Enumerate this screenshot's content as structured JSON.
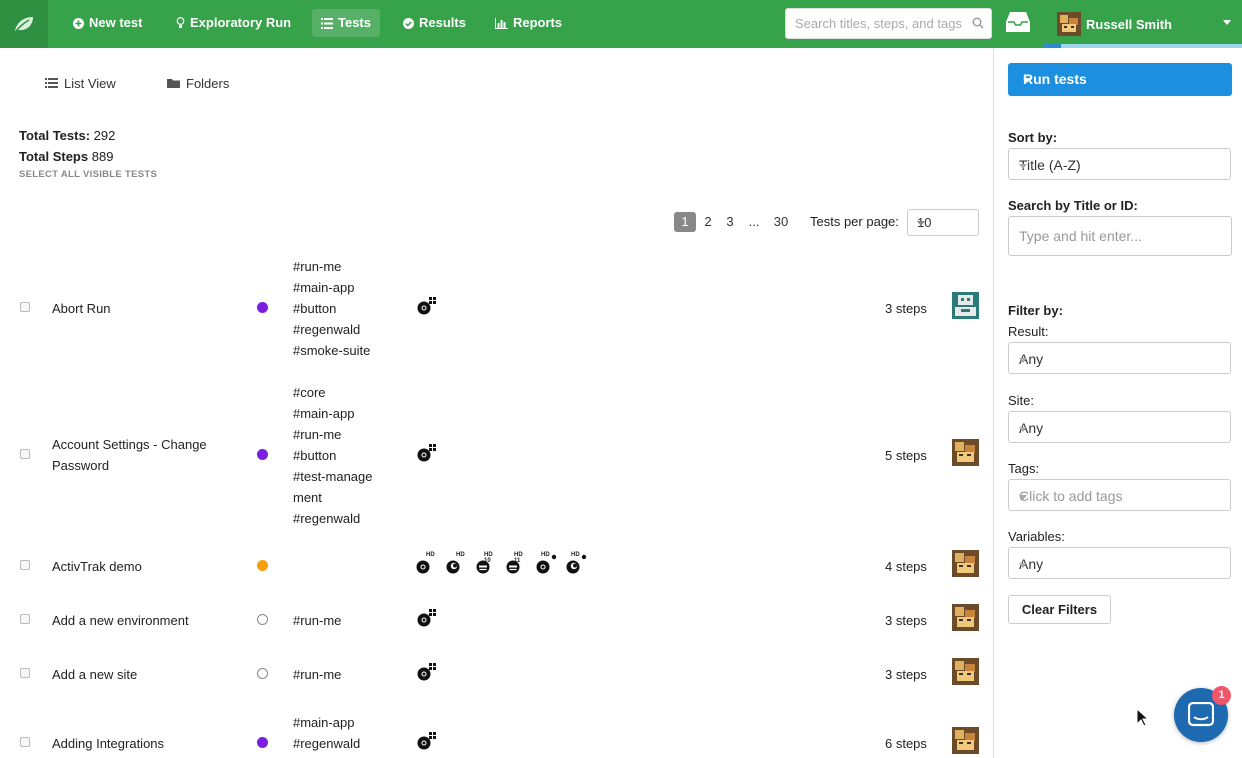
{
  "nav": {
    "items": [
      {
        "label": "New test",
        "icon": "plus-circle-icon"
      },
      {
        "label": "Exploratory Run",
        "icon": "lightbulb-icon"
      },
      {
        "label": "Tests",
        "icon": "list-icon"
      },
      {
        "label": "Results",
        "icon": "check-circle-icon"
      },
      {
        "label": "Reports",
        "icon": "bar-chart-icon"
      }
    ],
    "search_placeholder": "Search titles, steps, and tags",
    "user_name": "Russell Smith"
  },
  "main": {
    "view_tabs": {
      "list": "List View",
      "folders": "Folders"
    },
    "totals": {
      "tests_label": "Total Tests:",
      "tests_value": "292",
      "steps_label": "Total Steps",
      "steps_value": "889"
    },
    "select_all": "SELECT ALL VISIBLE TESTS",
    "pagination": {
      "pages": [
        "1",
        "2",
        "3",
        "...",
        "30"
      ],
      "current": "1",
      "per_page_label": "Tests per page:",
      "per_page_value": "10"
    },
    "rows": [
      {
        "title": "Abort Run",
        "status_color": "#7a1fe0",
        "tags": [
          "#run-me",
          "#main-app",
          "#button",
          "#regenwald",
          "#smoke-suite"
        ],
        "steps": "3 steps"
      },
      {
        "title": "Account Settings - Change Password",
        "status_color": "#7a1fe0",
        "tags": [
          "#core",
          "#main-app",
          "#run-me",
          "#button",
          "#test-management",
          "#regenwald"
        ],
        "steps": "5 steps"
      },
      {
        "title": "ActivTrak demo",
        "status_color": "#f5a00f",
        "tags": [],
        "steps": "4 steps",
        "browser_labels": [
          "HD",
          "HD",
          "HD 10",
          "HD 11",
          "HD",
          "HD"
        ]
      },
      {
        "title": "Add a new environment",
        "status_color": "none",
        "tags": [
          "#run-me"
        ],
        "steps": "3 steps"
      },
      {
        "title": "Add a new site",
        "status_color": "none",
        "tags": [
          "#run-me"
        ],
        "steps": "3 steps"
      },
      {
        "title": "Adding Integrations",
        "status_color": "#7a1fe0",
        "tags": [
          "#main-app",
          "#regenwald"
        ],
        "steps": "6 steps"
      }
    ]
  },
  "sidebar": {
    "run_button": "Run tests",
    "sort_label": "Sort by:",
    "sort_value": "Title (A-Z)",
    "search_label": "Search by Title or ID:",
    "search_placeholder": "Type and hit enter...",
    "filter_label": "Filter by:",
    "result_label": "Result:",
    "result_value": "Any",
    "site_label": "Site:",
    "site_value": "Any",
    "tags_label": "Tags:",
    "tags_placeholder": "Click to add tags",
    "variables_label": "Variables:",
    "variables_value": "Any",
    "clear_button": "Clear Filters",
    "chat_badge": "1"
  },
  "colors": {
    "nav_green": "#36a24a",
    "run_blue": "#1c8fe0",
    "purple_status": "#7a1fe0",
    "orange_status": "#f5a00f"
  }
}
